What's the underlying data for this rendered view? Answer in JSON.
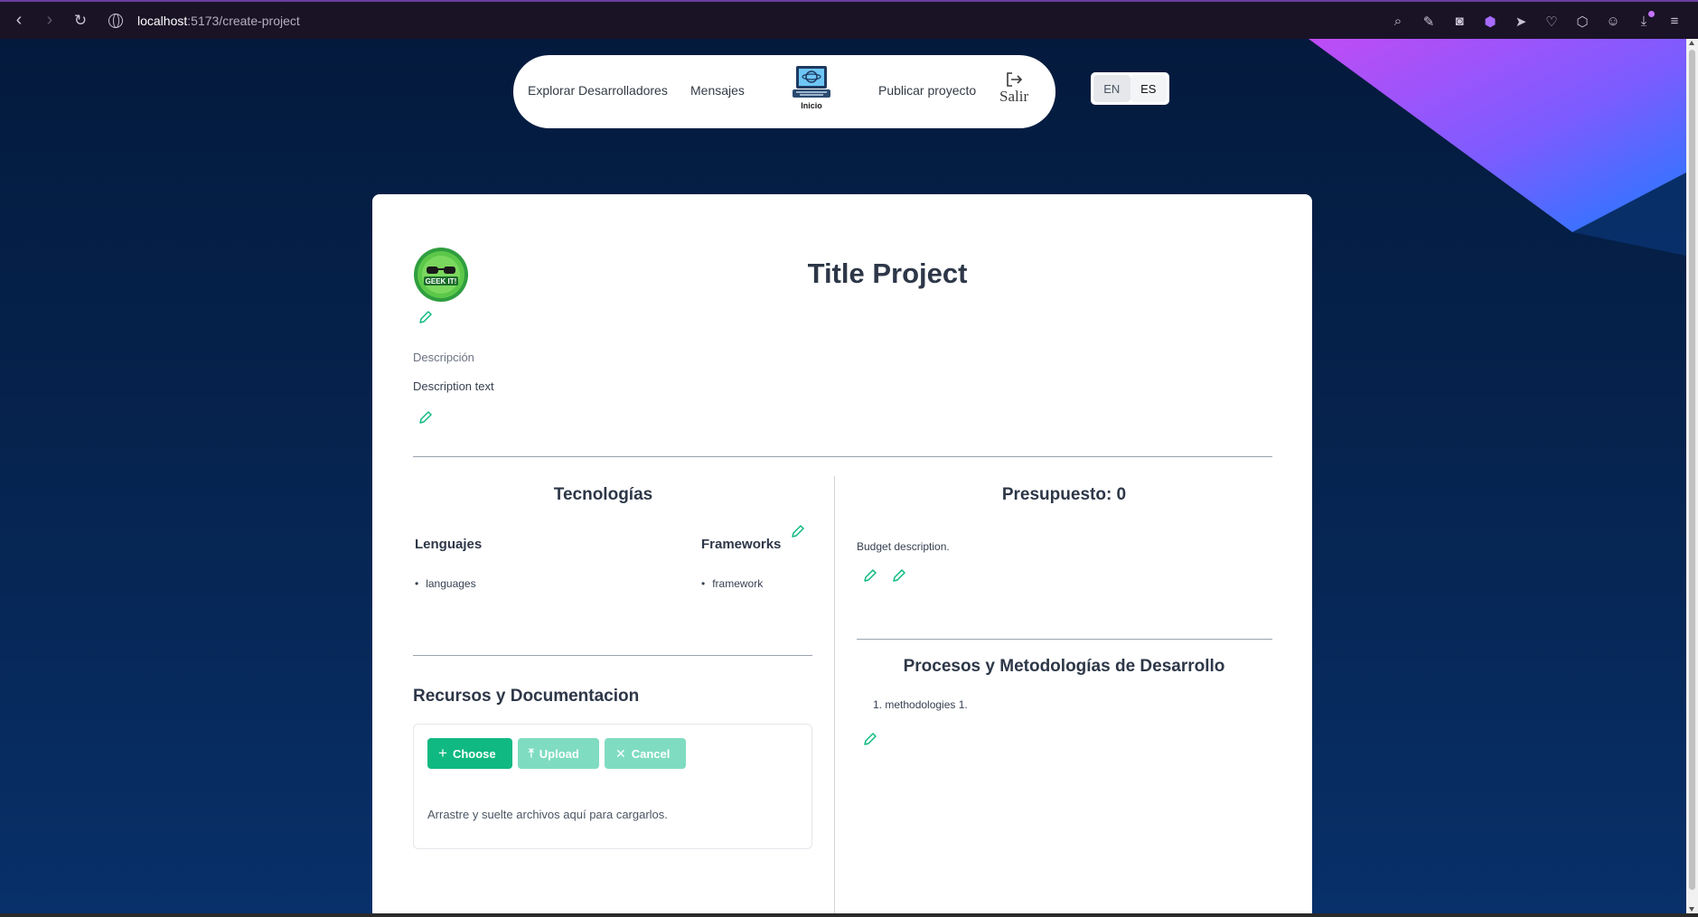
{
  "browser": {
    "url_host": "localhost",
    "url_path": ":5173/create-project"
  },
  "nav": {
    "explore_label": "Explorar Desarrolladores",
    "messages_label": "Mensajes",
    "home_label": "Inicio",
    "publish_label": "Publicar proyecto",
    "logout_label": "Salir"
  },
  "lang": {
    "en_label": "EN",
    "es_label": "ES",
    "selected": "ES"
  },
  "project": {
    "logo_text": "GEEK IT!",
    "title": "Title Project",
    "description_label": "Descripción",
    "description_text": "Description text"
  },
  "technologies": {
    "title": "Tecnologías",
    "languages_title": "Lenguajes",
    "languages": [
      "languages"
    ],
    "frameworks_title": "Frameworks",
    "frameworks": [
      "framework"
    ]
  },
  "resources": {
    "title": "Recursos y Documentacion",
    "choose_label": "Choose",
    "upload_label": "Upload",
    "cancel_label": "Cancel",
    "drop_text": "Arrastre y suelte archivos aquí para cargarlos."
  },
  "budget": {
    "title": "Presupuesto: 0",
    "description": "Budget description."
  },
  "methodologies": {
    "title": "Procesos y Metodologías de Desarrollo",
    "items": [
      "1. methodologies 1."
    ]
  },
  "colors": {
    "accent": "#10b981",
    "page_bg": "#041a3d",
    "text_dark": "#2d3748"
  }
}
